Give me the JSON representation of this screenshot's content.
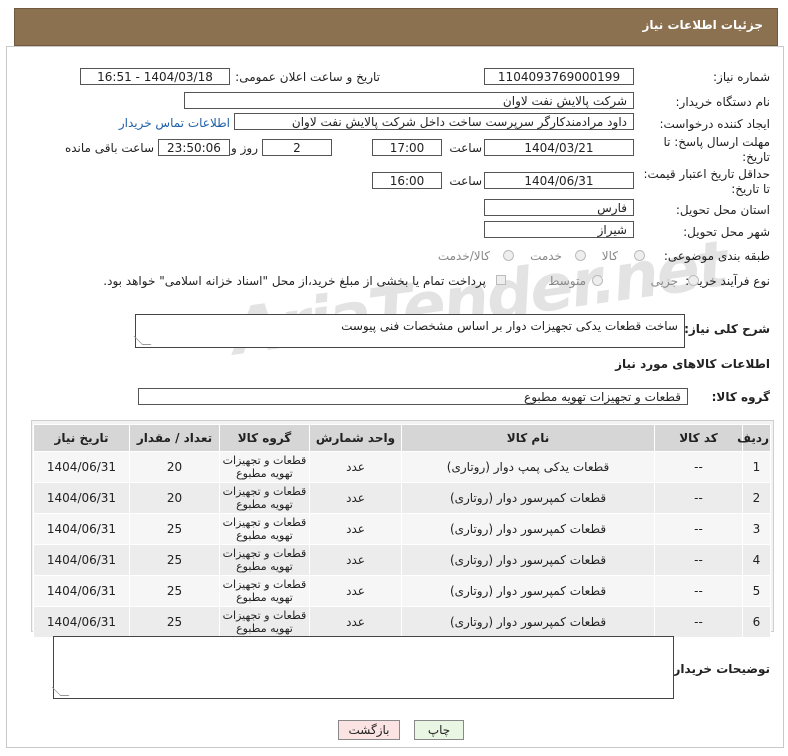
{
  "header": {
    "title": "جزئیات اطلاعات نیاز"
  },
  "watermark": "AriaTender.net",
  "form": {
    "need_number_label": "شماره نیاز:",
    "need_number": "1104093769000199",
    "announce_label": "تاریخ و ساعت اعلان عمومی:",
    "announce_value": "1404/03/18 - 16:51",
    "buyer_org_label": "نام دستگاه خریدار:",
    "buyer_org": "شرکت پالایش نفت لاوان",
    "requester_label": "ایجاد کننده درخواست:",
    "requester": "داود مرادمندکارگر سرپرست ساخت داخل شرکت پالایش نفت لاوان",
    "contact_link": "اطلاعات تماس خریدار",
    "deadline_label_1": "مهلت ارسال پاسخ: تا",
    "deadline_label_2": "تاریخ:",
    "deadline_date": "1404/03/21",
    "time_label": "ساعت",
    "deadline_time": "17:00",
    "days_value": "2",
    "days_label": "روز و",
    "remaining_time": "23:50:06",
    "remaining_label": "ساعت باقی مانده",
    "price_label_1": "حداقل تاریخ اعتبار قیمت:",
    "price_label_2": "تا تاریخ:",
    "price_date": "1404/06/31",
    "price_time": "16:00",
    "province_label": "استان محل تحویل:",
    "province": "فارس",
    "city_label": "شهر محل تحویل:",
    "city": "شیراز",
    "category_label": "طبقه بندی موضوعی:",
    "category_options": [
      "کالا",
      "خدمت",
      "کالا/خدمت"
    ],
    "process_label": "نوع فرآیند خرید :",
    "process_options": [
      "جزیی",
      "متوسط"
    ],
    "payment_note": "پرداخت تمام یا بخشی از مبلغ خرید،از محل \"اسناد خزانه اسلامی\" خواهد بود."
  },
  "description": {
    "label": "شرح کلی نیاز:",
    "text": "ساخت قطعات یدکی تجهیزات دوار بر اساس مشخصات فنی پیوست"
  },
  "goods": {
    "section_title": "اطلاعات کالاهای مورد نیاز",
    "group_label": "گروه کالا:",
    "group_value": "قطعات و تجهیزات تهویه مطبوع",
    "columns": [
      "ردیف",
      "کد کالا",
      "نام کالا",
      "واحد شمارش",
      "گروه کالا",
      "تعداد / مقدار",
      "تاریخ نیاز"
    ],
    "rows": [
      {
        "idx": "1",
        "code": "--",
        "name": "قطعات یدکی پمپ دوار (روتاری)",
        "unit": "عدد",
        "group_l1": "قطعات و تجهیزات",
        "group_l2": "تهویه مطبوع",
        "qty": "20",
        "date": "1404/06/31"
      },
      {
        "idx": "2",
        "code": "--",
        "name": "قطعات کمپرسور دوار (روتاری)",
        "unit": "عدد",
        "group_l1": "قطعات و تجهیزات",
        "group_l2": "تهویه مطبوع",
        "qty": "20",
        "date": "1404/06/31"
      },
      {
        "idx": "3",
        "code": "--",
        "name": "قطعات کمپرسور دوار (روتاری)",
        "unit": "عدد",
        "group_l1": "قطعات و تجهیزات",
        "group_l2": "تهویه مطبوع",
        "qty": "25",
        "date": "1404/06/31"
      },
      {
        "idx": "4",
        "code": "--",
        "name": "قطعات کمپرسور دوار (روتاری)",
        "unit": "عدد",
        "group_l1": "قطعات و تجهیزات",
        "group_l2": "تهویه مطبوع",
        "qty": "25",
        "date": "1404/06/31"
      },
      {
        "idx": "5",
        "code": "--",
        "name": "قطعات کمپرسور دوار (روتاری)",
        "unit": "عدد",
        "group_l1": "قطعات و تجهیزات",
        "group_l2": "تهویه مطبوع",
        "qty": "25",
        "date": "1404/06/31"
      },
      {
        "idx": "6",
        "code": "--",
        "name": "قطعات کمپرسور دوار (روتاری)",
        "unit": "عدد",
        "group_l1": "قطعات و تجهیزات",
        "group_l2": "تهویه مطبوع",
        "qty": "25",
        "date": "1404/06/31"
      }
    ]
  },
  "buyer_notes": {
    "label": "توضیحات خریدار:"
  },
  "buttons": {
    "print": "چاپ",
    "back": "بازگشت"
  }
}
